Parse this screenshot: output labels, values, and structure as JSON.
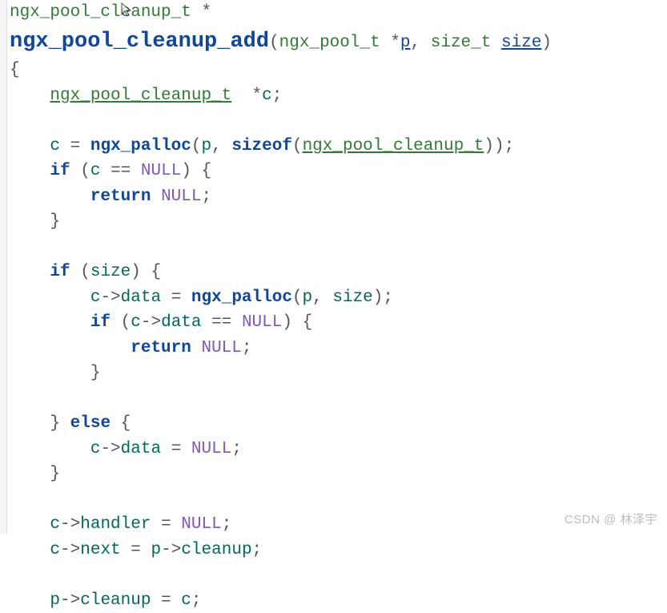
{
  "code": {
    "line1": {
      "ret_type": "ngx_pool_cleanup_t",
      "star": " *"
    },
    "line2": {
      "func_name": "ngx_pool_cleanup_add",
      "arg1_type": "ngx_pool_t",
      "arg1_name": "p",
      "arg2_type": "size_t",
      "arg2_name": "size"
    },
    "line3": {
      "brace": "{"
    },
    "line4": {
      "decl_type": "ngx_pool_cleanup_t",
      "decl_name": "c"
    },
    "line6": {
      "lhs": "c",
      "func": "ngx_palloc",
      "arg1": "p",
      "sizeof_kw": "sizeof",
      "sizeof_arg": "ngx_pool_cleanup_t"
    },
    "line7": {
      "kw": "if",
      "cond_l": "c",
      "cond_r": "NULL"
    },
    "line8": {
      "kw": "return",
      "val": "NULL"
    },
    "line11": {
      "kw": "if",
      "cond": "size"
    },
    "line12": {
      "lhs_obj": "c",
      "lhs_mem": "data",
      "func": "ngx_palloc",
      "arg1": "p",
      "arg2": "size"
    },
    "line13": {
      "kw": "if",
      "cond_obj": "c",
      "cond_mem": "data",
      "cond_r": "NULL"
    },
    "line14": {
      "kw": "return",
      "val": "NULL"
    },
    "line17": {
      "kw": "else"
    },
    "line18": {
      "lhs_obj": "c",
      "lhs_mem": "data",
      "rhs": "NULL"
    },
    "line21": {
      "lhs_obj": "c",
      "lhs_mem": "handler",
      "rhs": "NULL"
    },
    "line22": {
      "lhs_obj": "c",
      "lhs_mem": "next",
      "rhs_obj": "p",
      "rhs_mem": "cleanup"
    },
    "line24": {
      "lhs_obj": "p",
      "lhs_mem": "cleanup",
      "rhs": "c"
    }
  },
  "watermark": "CSDN @ 林泽宇"
}
